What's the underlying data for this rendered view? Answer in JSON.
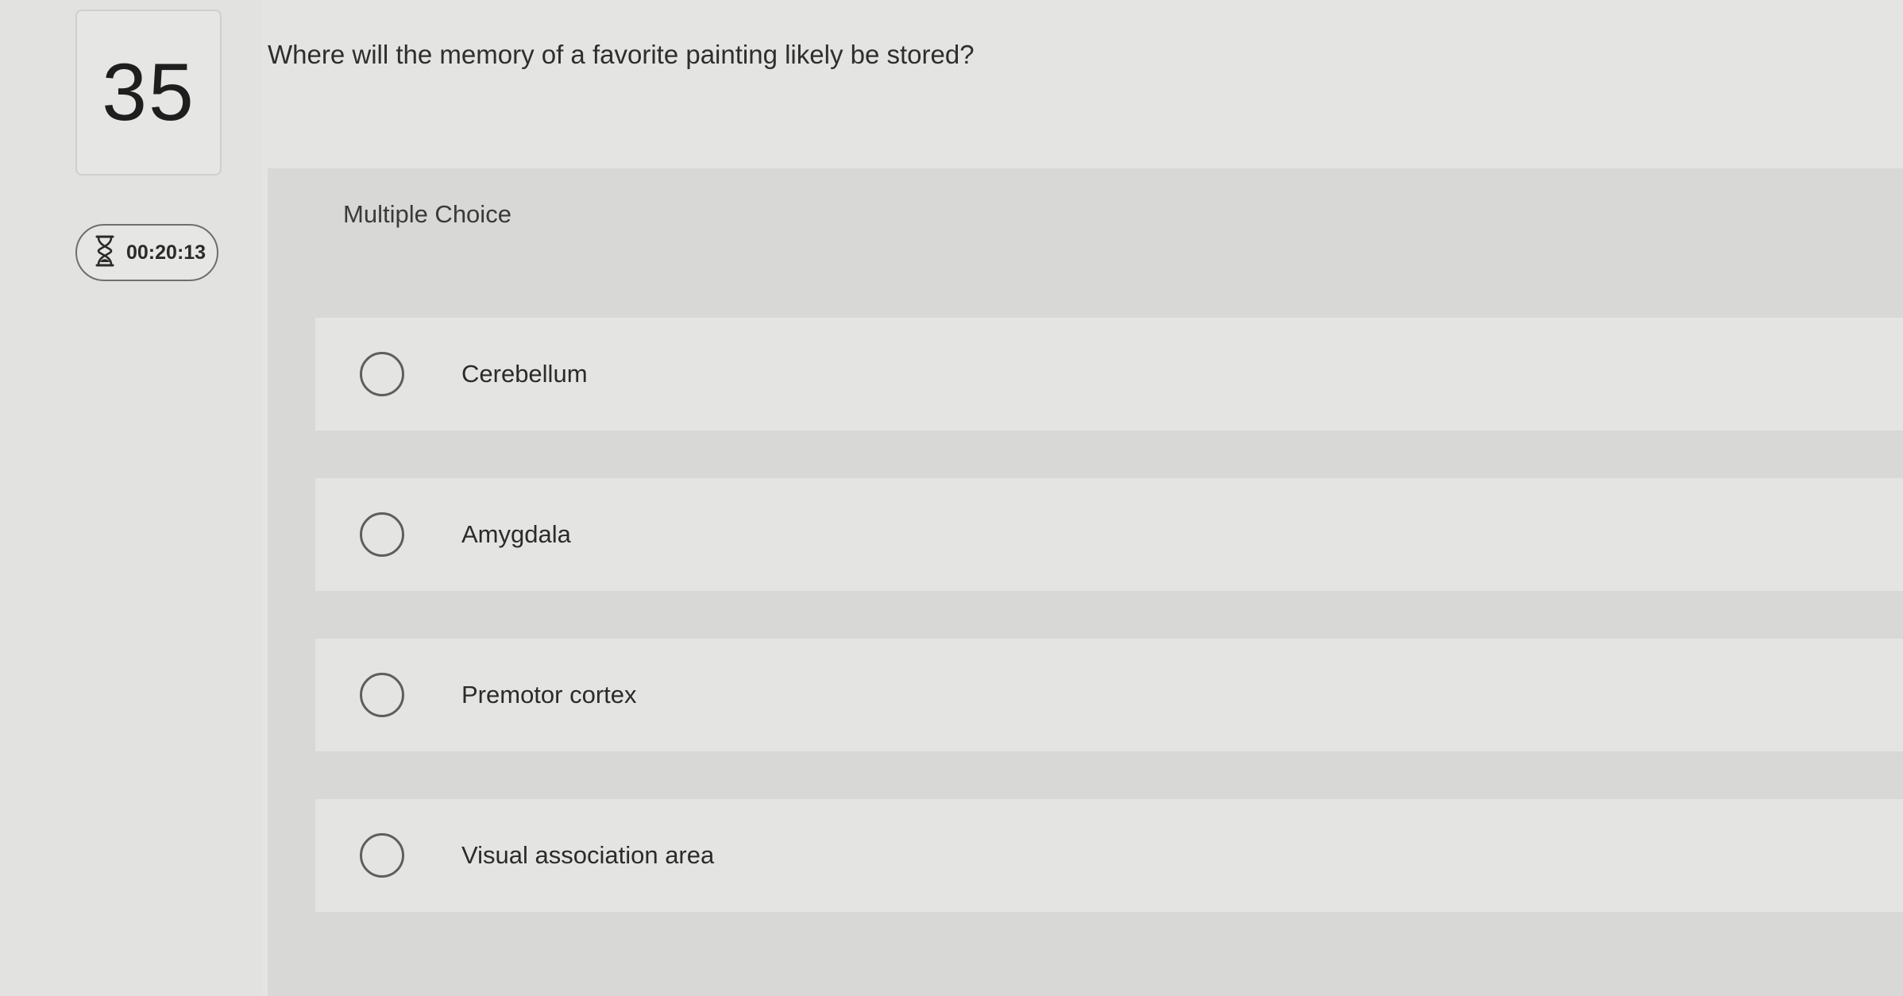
{
  "question_number": "35",
  "timer": {
    "icon": "hourglass-icon",
    "time": "00:20:13"
  },
  "question_text": "Where will the memory of a favorite painting likely be stored?",
  "question_type": "Multiple Choice",
  "options": [
    {
      "label": "Cerebellum"
    },
    {
      "label": "Amygdala"
    },
    {
      "label": "Premotor cortex"
    },
    {
      "label": "Visual association area"
    }
  ]
}
